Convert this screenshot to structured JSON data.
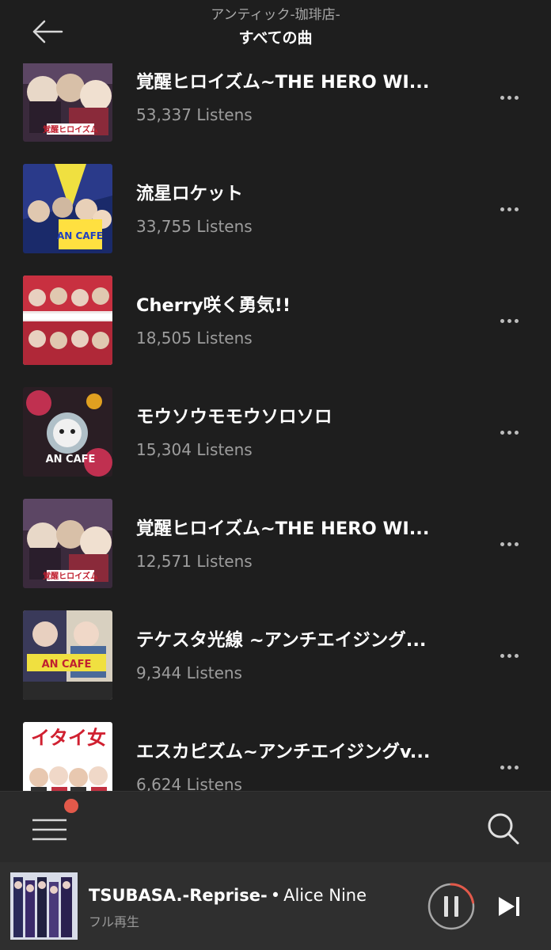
{
  "header": {
    "artist": "アンティック-珈琲店-",
    "title": "すべての曲"
  },
  "songs": [
    {
      "title": "覚醒ヒロイズム~THE HERO WI...",
      "listens": "53,337 Listens"
    },
    {
      "title": "流星ロケット",
      "listens": "33,755 Listens"
    },
    {
      "title": "Cherry咲く勇気!!",
      "listens": "18,505 Listens"
    },
    {
      "title": "モウソウモモウソロソロ",
      "listens": "15,304 Listens"
    },
    {
      "title": "覚醒ヒロイズム~THE HERO WI...",
      "listens": "12,571 Listens"
    },
    {
      "title": "テケスタ光線 ~アンチエイジング...",
      "listens": "9,344 Listens"
    },
    {
      "title": "エスカピズム~アンチエイジングv...",
      "listens": "6,624 Listens"
    }
  ],
  "now_playing": {
    "track": "TSUBASA.-Reprise-",
    "separator": "•",
    "artist": "Alice Nine",
    "subtitle": "フル再生"
  },
  "colors": {
    "background": "#1e1e1e",
    "accent_notification": "#e2594a",
    "progress_ring": "#e2594a"
  },
  "icons": {
    "back": "arrow-left-icon",
    "more": "more-dots-icon",
    "menu": "hamburger-menu-icon",
    "search": "search-icon",
    "pause": "pause-icon",
    "next": "skip-next-icon"
  }
}
